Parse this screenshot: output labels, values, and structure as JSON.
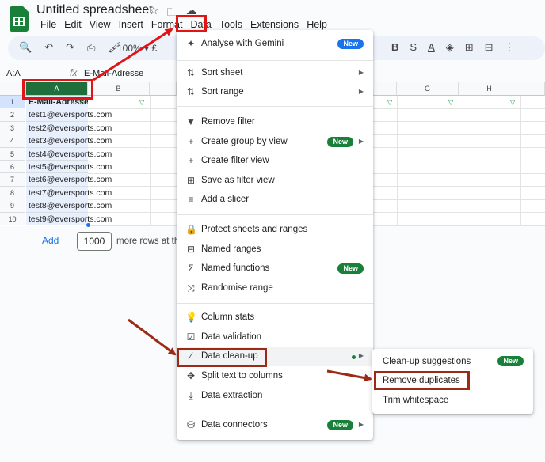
{
  "header": {
    "title": "Untitled spreadsheet",
    "icons": [
      "star-icon",
      "move-folder-icon",
      "cloud-status-icon"
    ],
    "menu": [
      "File",
      "Edit",
      "View",
      "Insert",
      "Format",
      "Data",
      "Tools",
      "Extensions",
      "Help"
    ]
  },
  "toolbar": {
    "zoom": "100%",
    "currency_partial": "£",
    "bold": "B",
    "text_color": "A"
  },
  "formula_bar": {
    "name_box": "A:A",
    "fx": "fx",
    "content": "E-Mail-Adresse"
  },
  "grid": {
    "columns": [
      "A",
      "B",
      "G",
      "H"
    ],
    "rows": [
      "1",
      "2",
      "3",
      "4",
      "5",
      "6",
      "7",
      "8",
      "9",
      "10"
    ],
    "cells": [
      "E-Mail-Adresse",
      "test1@eversports.com",
      "test2@eversports.com",
      "test3@eversports.com",
      "test4@eversports.com",
      "test5@eversports.com",
      "test6@eversports.com",
      "test7@eversports.com",
      "test8@eversports.com",
      "test9@eversports.com"
    ]
  },
  "footer": {
    "add_label": "Add",
    "rows_count": "1000",
    "more_rows_text": "more rows at th"
  },
  "data_menu": {
    "items": [
      {
        "label": "Analyse with Gemini",
        "icon": "gemini-sparkle-icon",
        "badge": "New"
      },
      {
        "label": "Sort sheet",
        "icon": "sort-icon"
      },
      {
        "label": "Sort range",
        "icon": "sort-range-icon"
      },
      {
        "label": "Remove filter",
        "icon": "filter-icon"
      },
      {
        "label": "Create group by view",
        "icon": "plus-icon",
        "badge": "New"
      },
      {
        "label": "Create filter view",
        "icon": "plus-icon"
      },
      {
        "label": "Save as filter view",
        "icon": "save-view-icon"
      },
      {
        "label": "Add a slicer",
        "icon": "slicer-icon"
      },
      {
        "label": "Protect sheets and ranges",
        "icon": "lock-icon"
      },
      {
        "label": "Named ranges",
        "icon": "named-ranges-icon"
      },
      {
        "label": "Named functions",
        "icon": "sigma-icon",
        "badge": "New"
      },
      {
        "label": "Randomise range",
        "icon": "shuffle-icon"
      },
      {
        "label": "Column stats",
        "icon": "lightbulb-icon"
      },
      {
        "label": "Data validation",
        "icon": "data-validation-icon"
      },
      {
        "label": "Data clean-up",
        "icon": "magic-wand-icon"
      },
      {
        "label": "Split text to columns",
        "icon": "split-icon"
      },
      {
        "label": "Data extraction",
        "icon": "extract-icon"
      },
      {
        "label": "Data connectors",
        "icon": "database-icon",
        "badge": "New"
      }
    ]
  },
  "cleanup_submenu": {
    "items": [
      {
        "label": "Clean-up suggestions",
        "badge": "New"
      },
      {
        "label": "Remove duplicates"
      },
      {
        "label": "Trim whitespace"
      }
    ]
  },
  "colors": {
    "annotation_red": "#e01616",
    "annotation_brown": "#9b2a16",
    "sheets_green": "#188038"
  }
}
